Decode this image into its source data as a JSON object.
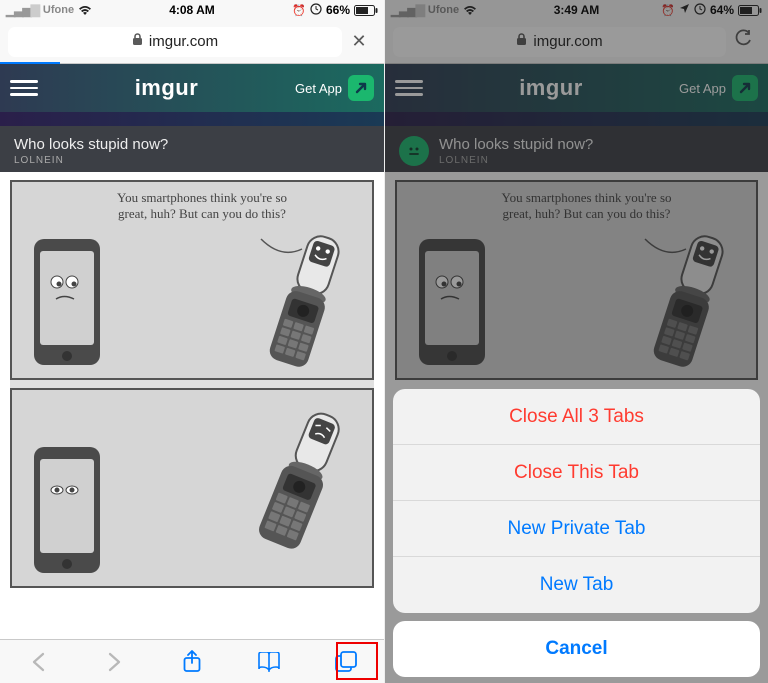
{
  "left": {
    "status": {
      "carrier": "Ufone",
      "time": "4:08 AM",
      "battery_pct": "66%"
    },
    "address": {
      "url": "imgur.com"
    },
    "header": {
      "logo": "imgur",
      "getapp": "Get App"
    },
    "post": {
      "title": "Who looks stupid now?",
      "author": "LOLNEIN"
    },
    "comic": {
      "speech": "You smartphones think you're so great, huh? But can you do this?"
    }
  },
  "right": {
    "status": {
      "carrier": "Ufone",
      "time": "3:49 AM",
      "battery_pct": "64%"
    },
    "address": {
      "url": "imgur.com"
    },
    "header": {
      "logo": "imgur",
      "getapp": "Get App"
    },
    "post": {
      "title": "Who looks stupid now?",
      "author": "LOLNEIN"
    },
    "comic": {
      "speech": "You smartphones think you're so great, huh? But can you do this?"
    },
    "sheet": {
      "close_all": "Close All 3 Tabs",
      "close_this": "Close This Tab",
      "new_private": "New Private Tab",
      "new_tab": "New Tab",
      "cancel": "Cancel"
    }
  }
}
